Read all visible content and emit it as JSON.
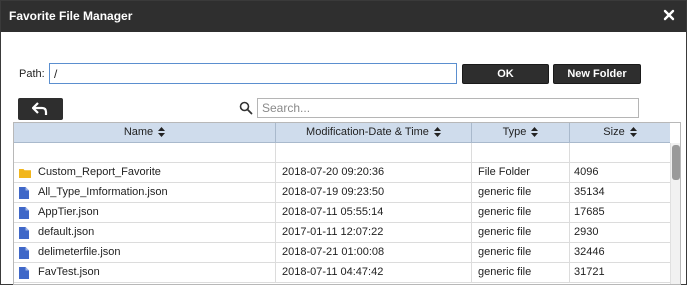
{
  "dialog": {
    "title": "Favorite File Manager",
    "close_icon": "close-icon"
  },
  "path": {
    "label": "Path:",
    "value": "/"
  },
  "buttons": {
    "ok": "OK",
    "new_folder": "New Folder"
  },
  "search": {
    "placeholder": "Search...",
    "value": ""
  },
  "table": {
    "columns": [
      "Name",
      "Modification-Date & Time",
      "Type",
      "Size"
    ],
    "rows": [
      {
        "name": "Custom_Report_Favorite",
        "date": "2018-07-20 09:20:36",
        "type": "File Folder",
        "size": "4096",
        "icon": "folder-icon"
      },
      {
        "name": "All_Type_Imformation.json",
        "date": "2018-07-19 09:23:50",
        "type": "generic file",
        "size": "35134",
        "icon": "file-icon"
      },
      {
        "name": "AppTier.json",
        "date": "2018-07-11 05:55:14",
        "type": "generic file",
        "size": "17685",
        "icon": "file-icon"
      },
      {
        "name": "default.json",
        "date": "2017-01-11 12:07:22",
        "type": "generic file",
        "size": "2930",
        "icon": "file-icon"
      },
      {
        "name": "delimeterfile.json",
        "date": "2018-07-21 01:00:08",
        "type": "generic file",
        "size": "32446",
        "icon": "file-icon"
      },
      {
        "name": "FavTest.json",
        "date": "2018-07-11 04:47:42",
        "type": "generic file",
        "size": "31721",
        "icon": "file-icon"
      }
    ]
  },
  "colors": {
    "titlebar": "#2f2f2f",
    "button": "#2e2e2e",
    "header": "#cfdcec",
    "folder": "#f2b61c",
    "file": "#3f67c8",
    "input_focus": "#5b8fcf"
  }
}
